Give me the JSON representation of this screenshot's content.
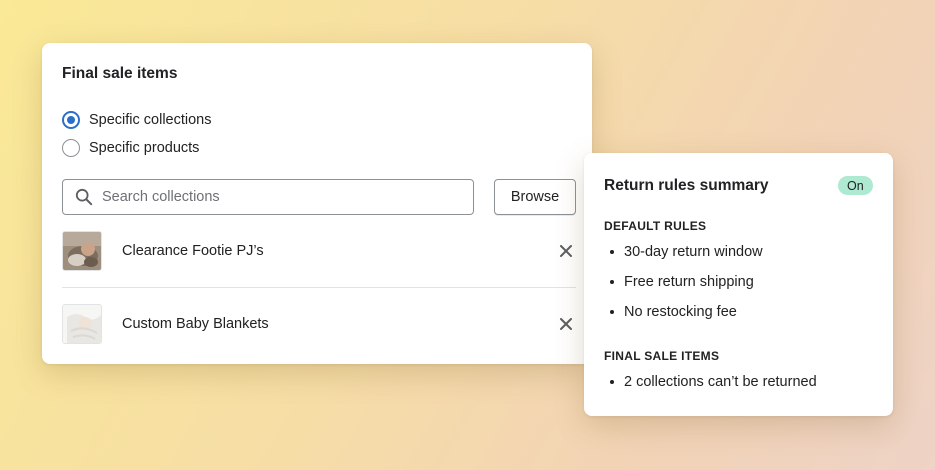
{
  "final_sale": {
    "title": "Final sale items",
    "options": [
      {
        "label": "Specific collections",
        "checked": true
      },
      {
        "label": "Specific products",
        "checked": false
      }
    ],
    "search": {
      "placeholder": "Search collections"
    },
    "browse_label": "Browse",
    "items": [
      {
        "label": "Clearance Footie PJ’s",
        "icon": "baby-photo-thumbnail"
      },
      {
        "label": "Custom Baby Blankets",
        "icon": "blanket-photo-thumbnail"
      }
    ]
  },
  "summary": {
    "title": "Return rules summary",
    "status": "On",
    "default_rules_heading": "DEFAULT RULES",
    "default_rules": [
      "30-day return window",
      "Free return shipping",
      "No restocking fee"
    ],
    "final_sale_heading": "FINAL SALE ITEMS",
    "final_sale_rules": [
      "2 collections can’t be returned"
    ]
  },
  "colors": {
    "accent": "#2c6ecb",
    "badge_bg": "#aee9d1",
    "text": "#202223"
  }
}
